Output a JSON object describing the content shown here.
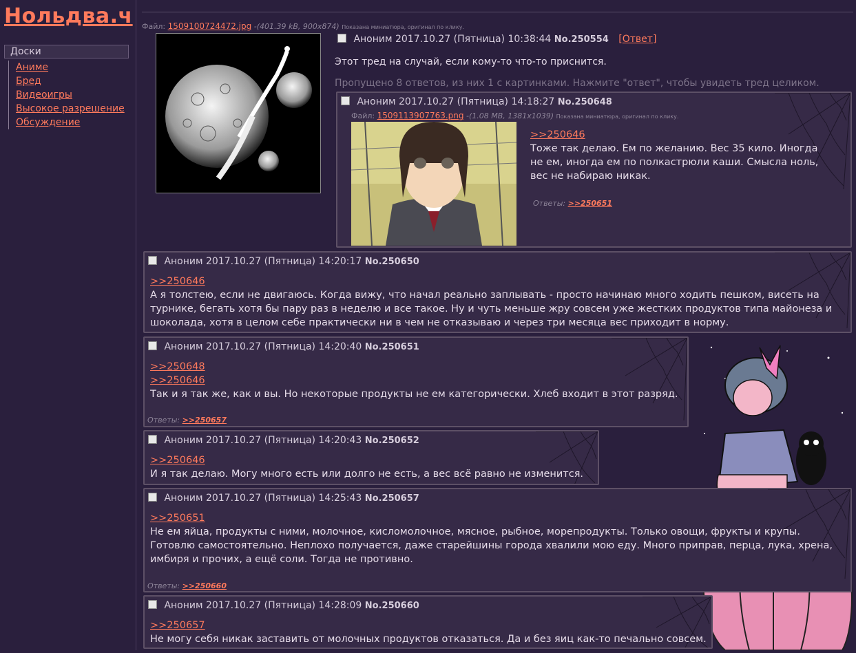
{
  "site": {
    "logo": "Нольдва.ч"
  },
  "sidebar": {
    "title": "Доски",
    "boards": [
      "Аниме",
      "Бред",
      "Видеоигры",
      "Высокое разрешение",
      "Обсуждение"
    ]
  },
  "op": {
    "file": {
      "label": "Файл:",
      "name": "1509100724472.jpg",
      "meta": "-(401.39 kB, 900x874)",
      "note": "Показана миниатюра, оригинал по клику."
    },
    "author": "Аноним",
    "date": "2017.10.27 (Пятница) 10:38:44",
    "num": "No.250554",
    "reply_open": "[",
    "reply_label": "Ответ",
    "reply_close": "]",
    "text": "Этот тред на случай, если кому-то что-то приснится.",
    "omitted": "Пропущено 8 ответов, из них 1 с картинками. Нажмите \"ответ\", чтобы увидеть тред целиком."
  },
  "posts": [
    {
      "author": "Аноним",
      "date": "2017.10.27 (Пятница) 14:18:27",
      "num": "No.250648",
      "file": {
        "label": "Файл:",
        "name": "1509113907763.png",
        "meta": "-(1.08 MB, 1381x1039)",
        "note": "Показана миниатюра, оригинал по клику."
      },
      "refs": [
        ">>250646"
      ],
      "lines": [
        "Тоже так делаю. Ем по желанию. Вес 35 кило. Иногда",
        "не ем, иногда ем по полкастрюли каши. Смысла ноль,",
        "вес не набираю никак."
      ],
      "answers_label": "Ответы:",
      "answers": ">>250651"
    },
    {
      "author": "Аноним",
      "date": "2017.10.27 (Пятница) 14:20:17",
      "num": "No.250650",
      "refs": [
        ">>250646"
      ],
      "lines": [
        "А я толстею, если не двигаюсь. Когда вижу, что начал реально заплывать - просто начинаю много ходить пешком, висеть на",
        "турнике, бегать хотя бы пару раз в неделю и все такое. Ну и чуть меньше жру совсем уже жестких продуктов типа майонеза и",
        "шоколада, хотя в целом себе практически ни в чем не отказываю и через три месяца вес приходит в норму."
      ]
    },
    {
      "author": "Аноним",
      "date": "2017.10.27 (Пятница) 14:20:40",
      "num": "No.250651",
      "refs": [
        ">>250648",
        ">>250646"
      ],
      "lines": [
        "Так и я так же, как и вы. Но некоторые продукты не ем категорически. Хлеб входит в этот разряд."
      ],
      "answers_label": "Ответы:",
      "answers": ">>250657"
    },
    {
      "author": "Аноним",
      "date": "2017.10.27 (Пятница) 14:20:43",
      "num": "No.250652",
      "refs": [
        ">>250646"
      ],
      "lines": [
        "И я так делаю. Могу много есть или долго не есть, а вес всё равно не изменится."
      ]
    },
    {
      "author": "Аноним",
      "date": "2017.10.27 (Пятница) 14:25:43",
      "num": "No.250657",
      "refs": [
        ">>250651"
      ],
      "lines": [
        "Не ем яйца, продукты с ними, молочное, кисломолочное, мясное, рыбное, морепродукты. Только овощи, фрукты и крупы.",
        "Готовлю самостоятельно. Неплохо получается, даже старейшины города хвалили мою еду. Много приправ, перца, лука, хрена,",
        "имбиря и прочих, а ещё соли. Тогда не противно."
      ],
      "answers_label": "Ответы:",
      "answers": ">>250660"
    },
    {
      "author": "Аноним",
      "date": "2017.10.27 (Пятница) 14:28:09",
      "num": "No.250660",
      "refs": [
        ">>250657"
      ],
      "lines": [
        "Не могу себя никак заставить от молочных продуктов отказаться. Да и без яиц как-то печально совсем."
      ]
    }
  ]
}
